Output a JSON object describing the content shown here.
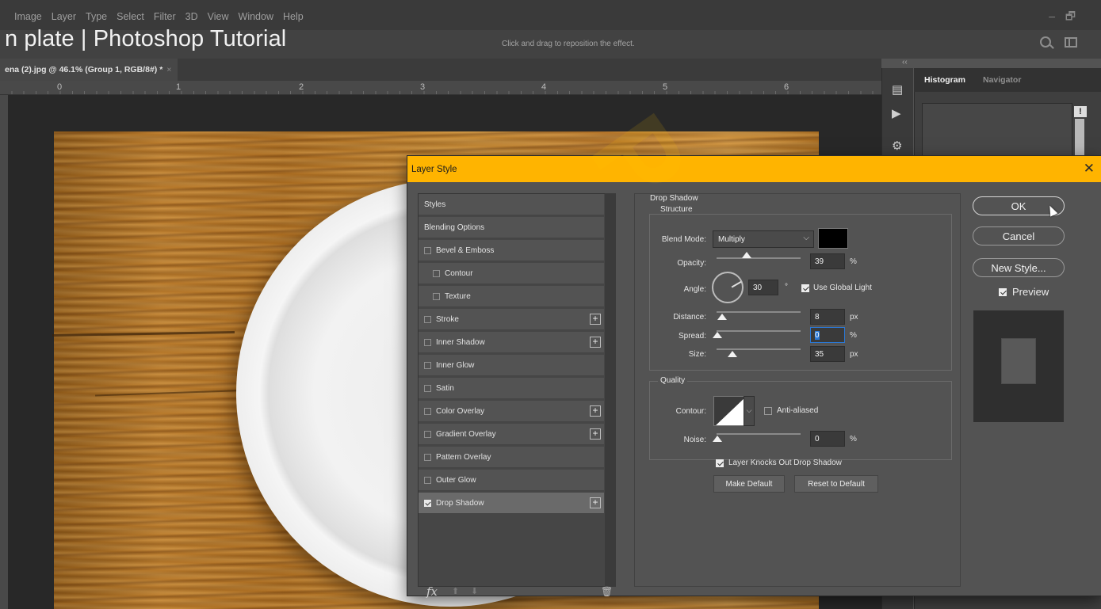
{
  "menubar": {
    "items": [
      "Image",
      "Layer",
      "Type",
      "Select",
      "Filter",
      "3D",
      "View",
      "Window",
      "Help"
    ],
    "minimize": "–",
    "restore": "🗗"
  },
  "video_title": "n plate | Photoshop Tutorial",
  "options_hint": "Click and drag to reposition the effect.",
  "doc_tab": {
    "label": "ena (2).jpg @ 46.1% (Group 1, RGB/8#) *",
    "close": "×"
  },
  "collapse": "‹‹",
  "ruler_numbers": [
    "0",
    "1",
    "2",
    "3",
    "4",
    "5",
    "6"
  ],
  "right_panel": {
    "tabs": [
      "Histogram",
      "Navigator"
    ],
    "strip_icons": [
      "histogram-icon",
      "play-icon",
      "properties-icon"
    ],
    "warning": "!"
  },
  "dialog": {
    "title": "Layer Style",
    "close": "✕",
    "styles_list": [
      {
        "label": "Styles",
        "checkbox": false,
        "checked": false,
        "indent": false,
        "plus": false
      },
      {
        "label": "Blending Options",
        "checkbox": false,
        "checked": false,
        "indent": false,
        "plus": false
      },
      {
        "label": "Bevel & Emboss",
        "checkbox": true,
        "checked": false,
        "indent": false,
        "plus": false
      },
      {
        "label": "Contour",
        "checkbox": true,
        "checked": false,
        "indent": true,
        "plus": false
      },
      {
        "label": "Texture",
        "checkbox": true,
        "checked": false,
        "indent": true,
        "plus": false
      },
      {
        "label": "Stroke",
        "checkbox": true,
        "checked": false,
        "indent": false,
        "plus": true
      },
      {
        "label": "Inner Shadow",
        "checkbox": true,
        "checked": false,
        "indent": false,
        "plus": true
      },
      {
        "label": "Inner Glow",
        "checkbox": true,
        "checked": false,
        "indent": false,
        "plus": false
      },
      {
        "label": "Satin",
        "checkbox": true,
        "checked": false,
        "indent": false,
        "plus": false
      },
      {
        "label": "Color Overlay",
        "checkbox": true,
        "checked": false,
        "indent": false,
        "plus": true
      },
      {
        "label": "Gradient Overlay",
        "checkbox": true,
        "checked": false,
        "indent": false,
        "plus": true
      },
      {
        "label": "Pattern Overlay",
        "checkbox": true,
        "checked": false,
        "indent": false,
        "plus": false
      },
      {
        "label": "Outer Glow",
        "checkbox": true,
        "checked": false,
        "indent": false,
        "plus": false
      },
      {
        "label": "Drop Shadow",
        "checkbox": true,
        "checked": true,
        "indent": false,
        "plus": true,
        "selected": true
      }
    ],
    "list_footer": {
      "fx": "fx",
      "up": "⬆",
      "down": "⬇",
      "trash": "🗑"
    },
    "drop_shadow": {
      "section": "Drop Shadow",
      "structure": "Structure",
      "blend_mode_label": "Blend Mode:",
      "blend_mode_value": "Multiply",
      "shadow_color": "#000000",
      "opacity_label": "Opacity:",
      "opacity_value": "39",
      "opacity_unit": "%",
      "angle_label": "Angle:",
      "angle_value": "30",
      "angle_unit": "°",
      "use_global_light": "Use Global Light",
      "distance_label": "Distance:",
      "distance_value": "8",
      "distance_unit": "px",
      "spread_label": "Spread:",
      "spread_value": "0",
      "spread_unit": "%",
      "size_label": "Size:",
      "size_value": "35",
      "size_unit": "px",
      "quality": "Quality",
      "contour_label": "Contour:",
      "anti_aliased": "Anti-aliased",
      "noise_label": "Noise:",
      "noise_value": "0",
      "noise_unit": "%",
      "knocks_out": "Layer Knocks Out Drop Shadow",
      "make_default": "Make Default",
      "reset_default": "Reset to Default"
    },
    "buttons": {
      "ok": "OK",
      "cancel": "Cancel",
      "new_style": "New Style...",
      "preview": "Preview"
    }
  }
}
